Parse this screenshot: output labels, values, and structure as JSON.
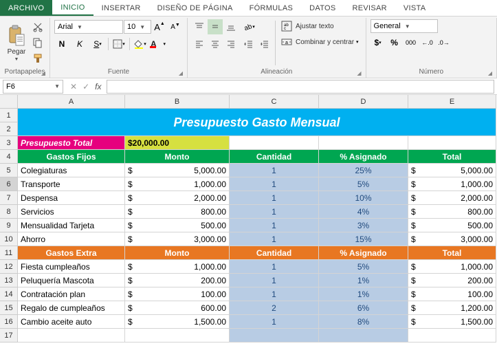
{
  "tabs": {
    "file": "ARCHIVO",
    "items": [
      "INICIO",
      "INSERTAR",
      "DISEÑO DE PÁGINA",
      "FÓRMULAS",
      "DATOS",
      "REVISAR",
      "VISTA"
    ],
    "active": 0
  },
  "ribbon": {
    "clipboard": {
      "paste": "Pegar",
      "label": "Portapapeles"
    },
    "font": {
      "name": "Arial",
      "size": "10",
      "bold": "N",
      "italic": "K",
      "underline": "S",
      "label": "Fuente"
    },
    "align": {
      "wrap": "Ajustar texto",
      "merge": "Combinar y centrar",
      "label": "Alineación"
    },
    "number": {
      "format": "General",
      "label": "Número"
    }
  },
  "namebox": "F6",
  "fx": "fx",
  "cols": [
    "A",
    "B",
    "C",
    "D",
    "E"
  ],
  "sheet": {
    "title": "Presupuesto Gasto Mensual",
    "budget_label": "Presupuesto Total",
    "budget_val": "$20,000.00",
    "hdr1": [
      "Gastos Fijos",
      "Monto",
      "Cantidad",
      "% Asignado",
      "Total"
    ],
    "rows1": [
      {
        "r": "5",
        "a": "Colegiaturas",
        "b": "5,000.00",
        "c": "1",
        "d": "25%",
        "e": "5,000.00"
      },
      {
        "r": "6",
        "a": "Transporte",
        "b": "1,000.00",
        "c": "1",
        "d": "5%",
        "e": "1,000.00"
      },
      {
        "r": "7",
        "a": "Despensa",
        "b": "2,000.00",
        "c": "1",
        "d": "10%",
        "e": "2,000.00"
      },
      {
        "r": "8",
        "a": "Servicios",
        "b": "800.00",
        "c": "1",
        "d": "4%",
        "e": "800.00"
      },
      {
        "r": "9",
        "a": "Mensualidad Tarjeta",
        "b": "500.00",
        "c": "1",
        "d": "3%",
        "e": "500.00"
      },
      {
        "r": "10",
        "a": "Ahorro",
        "b": "3,000.00",
        "c": "1",
        "d": "15%",
        "e": "3,000.00"
      }
    ],
    "hdr2": [
      "Gastos Extra",
      "Monto",
      "Cantidad",
      "% Asignado",
      "Total"
    ],
    "rows2": [
      {
        "r": "12",
        "a": "Fiesta cumpleaños",
        "b": "1,000.00",
        "c": "1",
        "d": "5%",
        "e": "1,000.00"
      },
      {
        "r": "13",
        "a": "Peluquería Mascota",
        "b": "200.00",
        "c": "1",
        "d": "1%",
        "e": "200.00"
      },
      {
        "r": "14",
        "a": "Contratación plan",
        "b": "100.00",
        "c": "1",
        "d": "1%",
        "e": "100.00"
      },
      {
        "r": "15",
        "a": "Regalo de cumpleaños",
        "b": "600.00",
        "c": "2",
        "d": "6%",
        "e": "1,200.00"
      },
      {
        "r": "16",
        "a": "Cambio aceite auto",
        "b": "1,500.00",
        "c": "1",
        "d": "8%",
        "e": "1,500.00"
      }
    ],
    "row3": "3",
    "row4": "4",
    "row11": "11",
    "row17": "17",
    "cur": "$"
  }
}
